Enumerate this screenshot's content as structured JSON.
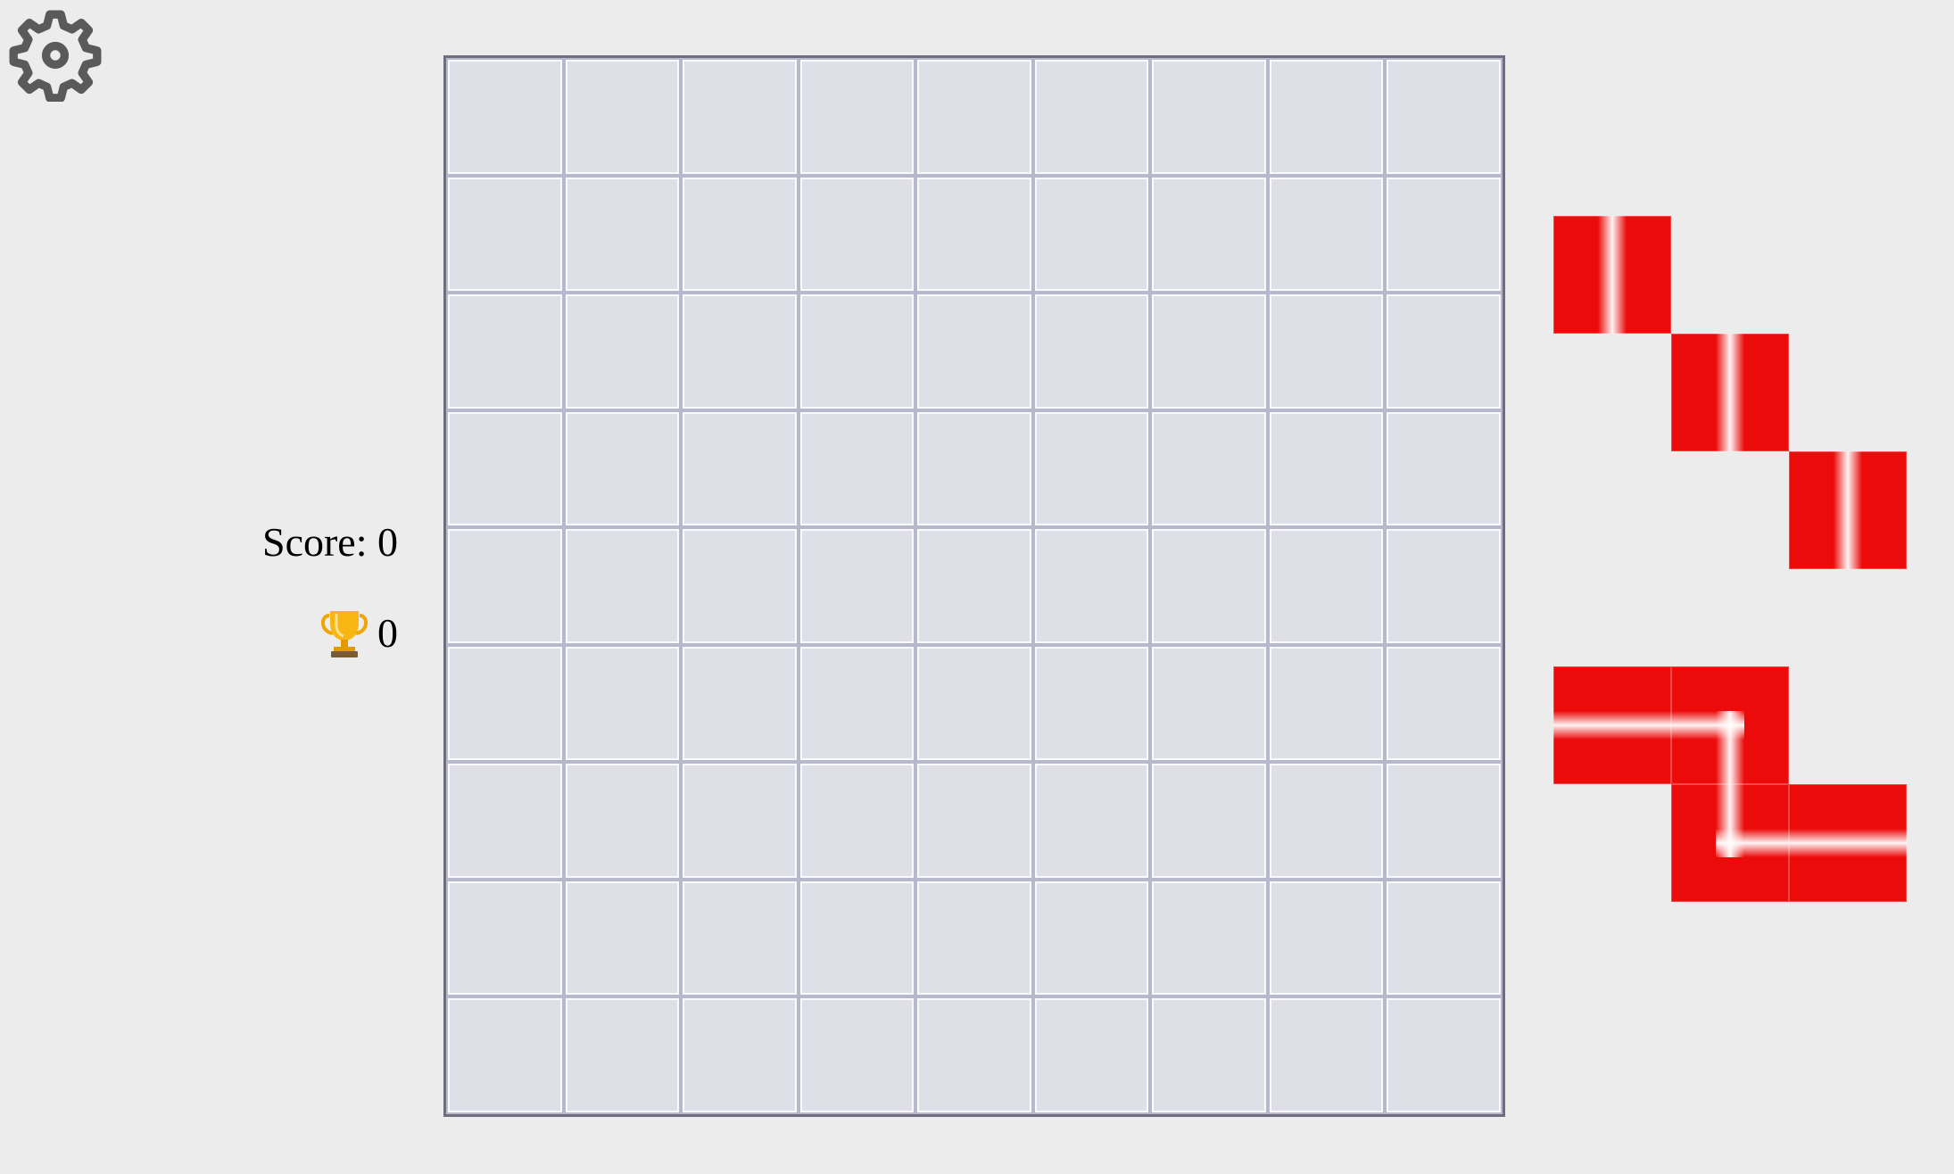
{
  "settings": {
    "icon": "gear-icon",
    "color": "#5a5a5a"
  },
  "score": {
    "label": "Score: 0",
    "best_value": "0",
    "best_icon": "trophy-icon"
  },
  "board": {
    "rows": 9,
    "cols": 9,
    "cell_color": "#dfdfe8",
    "border_color": "#6e6e80"
  },
  "pieces": [
    {
      "name": "diagonal-piece",
      "color": "#ec0b0b",
      "cells": [
        [
          0,
          0
        ],
        [
          1,
          1
        ],
        [
          2,
          2
        ]
      ]
    },
    {
      "name": "z-piece",
      "color": "#ec0b0b",
      "cells": [
        [
          0,
          0
        ],
        [
          0,
          1
        ],
        [
          1,
          1
        ],
        [
          1,
          2
        ]
      ]
    }
  ]
}
